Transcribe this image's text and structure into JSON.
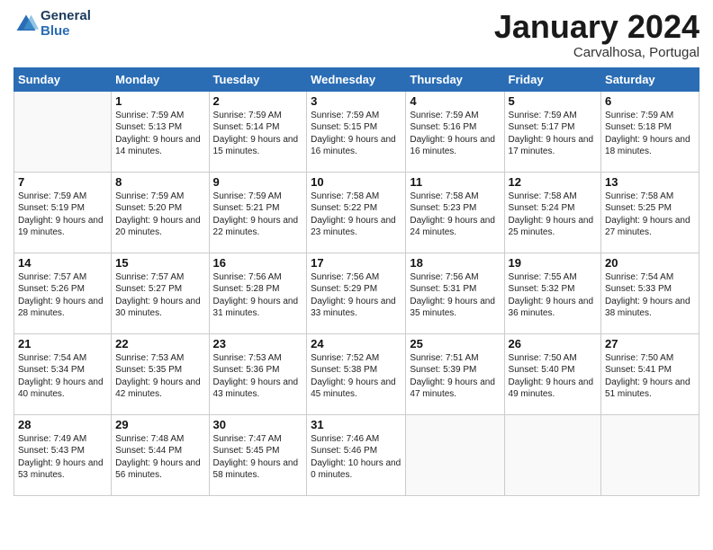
{
  "header": {
    "logo_text_general": "General",
    "logo_text_blue": "Blue",
    "month_title": "January 2024",
    "location": "Carvalhosa, Portugal"
  },
  "days_of_week": [
    "Sunday",
    "Monday",
    "Tuesday",
    "Wednesday",
    "Thursday",
    "Friday",
    "Saturday"
  ],
  "weeks": [
    [
      {
        "day": "",
        "sunrise": "",
        "sunset": "",
        "daylight": ""
      },
      {
        "day": "1",
        "sunrise": "Sunrise: 7:59 AM",
        "sunset": "Sunset: 5:13 PM",
        "daylight": "Daylight: 9 hours and 14 minutes."
      },
      {
        "day": "2",
        "sunrise": "Sunrise: 7:59 AM",
        "sunset": "Sunset: 5:14 PM",
        "daylight": "Daylight: 9 hours and 15 minutes."
      },
      {
        "day": "3",
        "sunrise": "Sunrise: 7:59 AM",
        "sunset": "Sunset: 5:15 PM",
        "daylight": "Daylight: 9 hours and 16 minutes."
      },
      {
        "day": "4",
        "sunrise": "Sunrise: 7:59 AM",
        "sunset": "Sunset: 5:16 PM",
        "daylight": "Daylight: 9 hours and 16 minutes."
      },
      {
        "day": "5",
        "sunrise": "Sunrise: 7:59 AM",
        "sunset": "Sunset: 5:17 PM",
        "daylight": "Daylight: 9 hours and 17 minutes."
      },
      {
        "day": "6",
        "sunrise": "Sunrise: 7:59 AM",
        "sunset": "Sunset: 5:18 PM",
        "daylight": "Daylight: 9 hours and 18 minutes."
      }
    ],
    [
      {
        "day": "7",
        "sunrise": "Sunrise: 7:59 AM",
        "sunset": "Sunset: 5:19 PM",
        "daylight": "Daylight: 9 hours and 19 minutes."
      },
      {
        "day": "8",
        "sunrise": "Sunrise: 7:59 AM",
        "sunset": "Sunset: 5:20 PM",
        "daylight": "Daylight: 9 hours and 20 minutes."
      },
      {
        "day": "9",
        "sunrise": "Sunrise: 7:59 AM",
        "sunset": "Sunset: 5:21 PM",
        "daylight": "Daylight: 9 hours and 22 minutes."
      },
      {
        "day": "10",
        "sunrise": "Sunrise: 7:58 AM",
        "sunset": "Sunset: 5:22 PM",
        "daylight": "Daylight: 9 hours and 23 minutes."
      },
      {
        "day": "11",
        "sunrise": "Sunrise: 7:58 AM",
        "sunset": "Sunset: 5:23 PM",
        "daylight": "Daylight: 9 hours and 24 minutes."
      },
      {
        "day": "12",
        "sunrise": "Sunrise: 7:58 AM",
        "sunset": "Sunset: 5:24 PM",
        "daylight": "Daylight: 9 hours and 25 minutes."
      },
      {
        "day": "13",
        "sunrise": "Sunrise: 7:58 AM",
        "sunset": "Sunset: 5:25 PM",
        "daylight": "Daylight: 9 hours and 27 minutes."
      }
    ],
    [
      {
        "day": "14",
        "sunrise": "Sunrise: 7:57 AM",
        "sunset": "Sunset: 5:26 PM",
        "daylight": "Daylight: 9 hours and 28 minutes."
      },
      {
        "day": "15",
        "sunrise": "Sunrise: 7:57 AM",
        "sunset": "Sunset: 5:27 PM",
        "daylight": "Daylight: 9 hours and 30 minutes."
      },
      {
        "day": "16",
        "sunrise": "Sunrise: 7:56 AM",
        "sunset": "Sunset: 5:28 PM",
        "daylight": "Daylight: 9 hours and 31 minutes."
      },
      {
        "day": "17",
        "sunrise": "Sunrise: 7:56 AM",
        "sunset": "Sunset: 5:29 PM",
        "daylight": "Daylight: 9 hours and 33 minutes."
      },
      {
        "day": "18",
        "sunrise": "Sunrise: 7:56 AM",
        "sunset": "Sunset: 5:31 PM",
        "daylight": "Daylight: 9 hours and 35 minutes."
      },
      {
        "day": "19",
        "sunrise": "Sunrise: 7:55 AM",
        "sunset": "Sunset: 5:32 PM",
        "daylight": "Daylight: 9 hours and 36 minutes."
      },
      {
        "day": "20",
        "sunrise": "Sunrise: 7:54 AM",
        "sunset": "Sunset: 5:33 PM",
        "daylight": "Daylight: 9 hours and 38 minutes."
      }
    ],
    [
      {
        "day": "21",
        "sunrise": "Sunrise: 7:54 AM",
        "sunset": "Sunset: 5:34 PM",
        "daylight": "Daylight: 9 hours and 40 minutes."
      },
      {
        "day": "22",
        "sunrise": "Sunrise: 7:53 AM",
        "sunset": "Sunset: 5:35 PM",
        "daylight": "Daylight: 9 hours and 42 minutes."
      },
      {
        "day": "23",
        "sunrise": "Sunrise: 7:53 AM",
        "sunset": "Sunset: 5:36 PM",
        "daylight": "Daylight: 9 hours and 43 minutes."
      },
      {
        "day": "24",
        "sunrise": "Sunrise: 7:52 AM",
        "sunset": "Sunset: 5:38 PM",
        "daylight": "Daylight: 9 hours and 45 minutes."
      },
      {
        "day": "25",
        "sunrise": "Sunrise: 7:51 AM",
        "sunset": "Sunset: 5:39 PM",
        "daylight": "Daylight: 9 hours and 47 minutes."
      },
      {
        "day": "26",
        "sunrise": "Sunrise: 7:50 AM",
        "sunset": "Sunset: 5:40 PM",
        "daylight": "Daylight: 9 hours and 49 minutes."
      },
      {
        "day": "27",
        "sunrise": "Sunrise: 7:50 AM",
        "sunset": "Sunset: 5:41 PM",
        "daylight": "Daylight: 9 hours and 51 minutes."
      }
    ],
    [
      {
        "day": "28",
        "sunrise": "Sunrise: 7:49 AM",
        "sunset": "Sunset: 5:43 PM",
        "daylight": "Daylight: 9 hours and 53 minutes."
      },
      {
        "day": "29",
        "sunrise": "Sunrise: 7:48 AM",
        "sunset": "Sunset: 5:44 PM",
        "daylight": "Daylight: 9 hours and 56 minutes."
      },
      {
        "day": "30",
        "sunrise": "Sunrise: 7:47 AM",
        "sunset": "Sunset: 5:45 PM",
        "daylight": "Daylight: 9 hours and 58 minutes."
      },
      {
        "day": "31",
        "sunrise": "Sunrise: 7:46 AM",
        "sunset": "Sunset: 5:46 PM",
        "daylight": "Daylight: 10 hours and 0 minutes."
      },
      {
        "day": "",
        "sunrise": "",
        "sunset": "",
        "daylight": ""
      },
      {
        "day": "",
        "sunrise": "",
        "sunset": "",
        "daylight": ""
      },
      {
        "day": "",
        "sunrise": "",
        "sunset": "",
        "daylight": ""
      }
    ]
  ]
}
